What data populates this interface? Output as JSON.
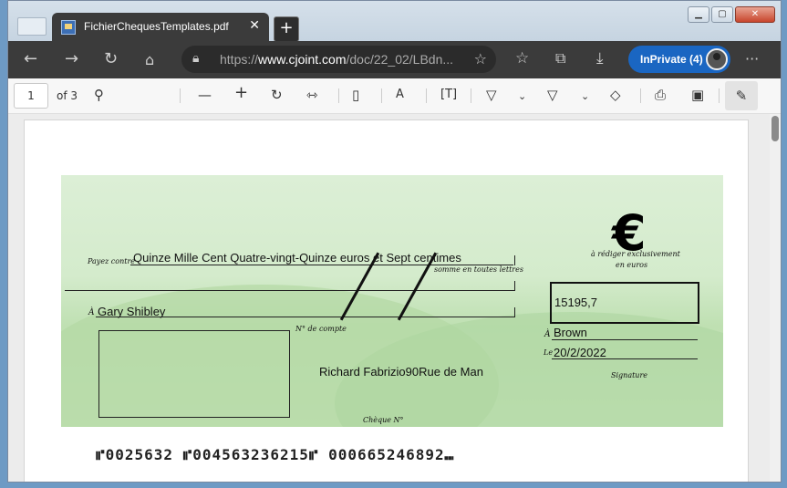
{
  "browser": {
    "tab_title": "FichierChequesTemplates.pdf",
    "tab_close": "✕",
    "new_tab": "+",
    "url_prefix": "https://",
    "url_domain": "www.cjoint.com",
    "url_path": "/doc/22_02/LBdn...",
    "inprivate_label": "InPrivate (4)",
    "menu": "···",
    "icons": [
      "back-icon",
      "forward-icon",
      "refresh-icon",
      "home-icon",
      "lock-icon",
      "favorite-icon",
      "favorites-icon",
      "collections-icon",
      "download-icon"
    ]
  },
  "pdf_toolbar": {
    "page": "1",
    "of_pages": "of 3",
    "icons": [
      "search-icon",
      "zoom-out-icon",
      "zoom-in-icon",
      "rotate-icon",
      "fit-width-icon",
      "page-view-icon",
      "read-aloud-icon",
      "text-icon",
      "draw-icon",
      "highlight-icon",
      "erase-icon",
      "print-icon",
      "save-icon",
      "pin-icon"
    ]
  },
  "cheque": {
    "pay_to_label": "Payez contre",
    "amount_words": "Quinze Mille Cent Quatre-vingt-Quinze euros et Sept centimes",
    "words_hint": "somme en toutes lettres",
    "to_label": "À",
    "payee": "Gary Shibley",
    "account_label": "N° de compte",
    "euro_symbol": "€",
    "euro_note_1": "à rédiger exclusivement",
    "euro_note_2": "en euros",
    "amount": "15195,7",
    "place_label": "À",
    "place": "Brown",
    "date_label": "Le",
    "date": "20/2/2022",
    "signature_label": "Signature",
    "issuer": "Richard Fabrizio90Rue de Man",
    "cheque_number_label": "Chèque N°"
  },
  "micr": {
    "line": "⑈0025632 ⑈0045632362​15⑈ 000665246892⑉"
  }
}
